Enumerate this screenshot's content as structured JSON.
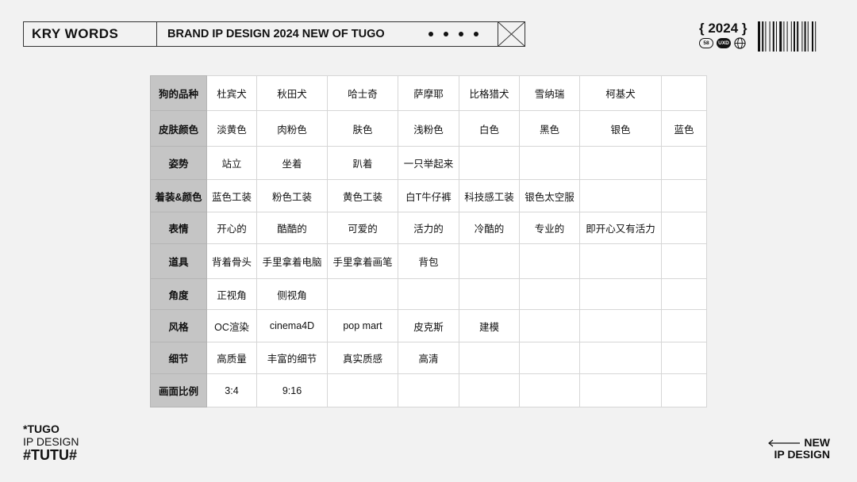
{
  "header": {
    "brand": "KRY WORDS",
    "subtitle": "BRAND IP DESIGN 2024 NEW OF TUGO"
  },
  "top_right": {
    "year": "{ 2024 }",
    "badge_1": "58",
    "badge_2": "UXD",
    "icons": [
      "globe-icon",
      "barcode"
    ]
  },
  "table": {
    "rows": [
      {
        "head": "狗的品种",
        "cells": [
          "杜宾犬",
          "秋田犬",
          "哈士奇",
          "萨摩耶",
          "比格猎犬",
          "雪纳瑞",
          "柯基犬",
          ""
        ]
      },
      {
        "head": "皮肤颜色",
        "cells": [
          "淡黄色",
          "肉粉色",
          "肤色",
          "浅粉色",
          "白色",
          "黑色",
          "银色",
          "蓝色"
        ]
      },
      {
        "head": "姿势",
        "cells": [
          "站立",
          "坐着",
          "趴着",
          "一只举起来",
          "",
          "",
          "",
          ""
        ]
      },
      {
        "head": "着装&颜色",
        "cells": [
          "蓝色工装",
          "粉色工装",
          "黄色工装",
          "白T牛仔裤",
          "科技感工装",
          "银色太空服",
          "",
          ""
        ]
      },
      {
        "head": "表情",
        "cells": [
          "开心的",
          "酷酷的",
          "可爱的",
          "活力的",
          "冷酷的",
          "专业的",
          "即开心又有活力",
          ""
        ]
      },
      {
        "head": "道具",
        "cells": [
          "背着骨头",
          "手里拿着电脑",
          "手里拿着画笔",
          "背包",
          "",
          "",
          "",
          ""
        ]
      },
      {
        "head": "角度",
        "cells": [
          "正视角",
          "侧视角",
          "",
          "",
          "",
          "",
          "",
          ""
        ]
      },
      {
        "head": "风格",
        "cells": [
          "OC渲染",
          "cinema4D",
          "pop mart",
          "皮克斯",
          "建模",
          "",
          "",
          ""
        ]
      },
      {
        "head": "细节",
        "cells": [
          "高质量",
          "丰富的细节",
          "真实质感",
          "高清",
          "",
          "",
          "",
          ""
        ]
      },
      {
        "head": "画面比例",
        "cells": [
          "3:4",
          "9:16",
          "",
          "",
          "",
          "",
          "",
          ""
        ]
      }
    ]
  },
  "footer_left": {
    "line1": "*TUGO",
    "line2": "IP DESIGN",
    "line3": "#TUTU#"
  },
  "footer_right": {
    "line1": "NEW",
    "line2": "IP DESIGN"
  }
}
